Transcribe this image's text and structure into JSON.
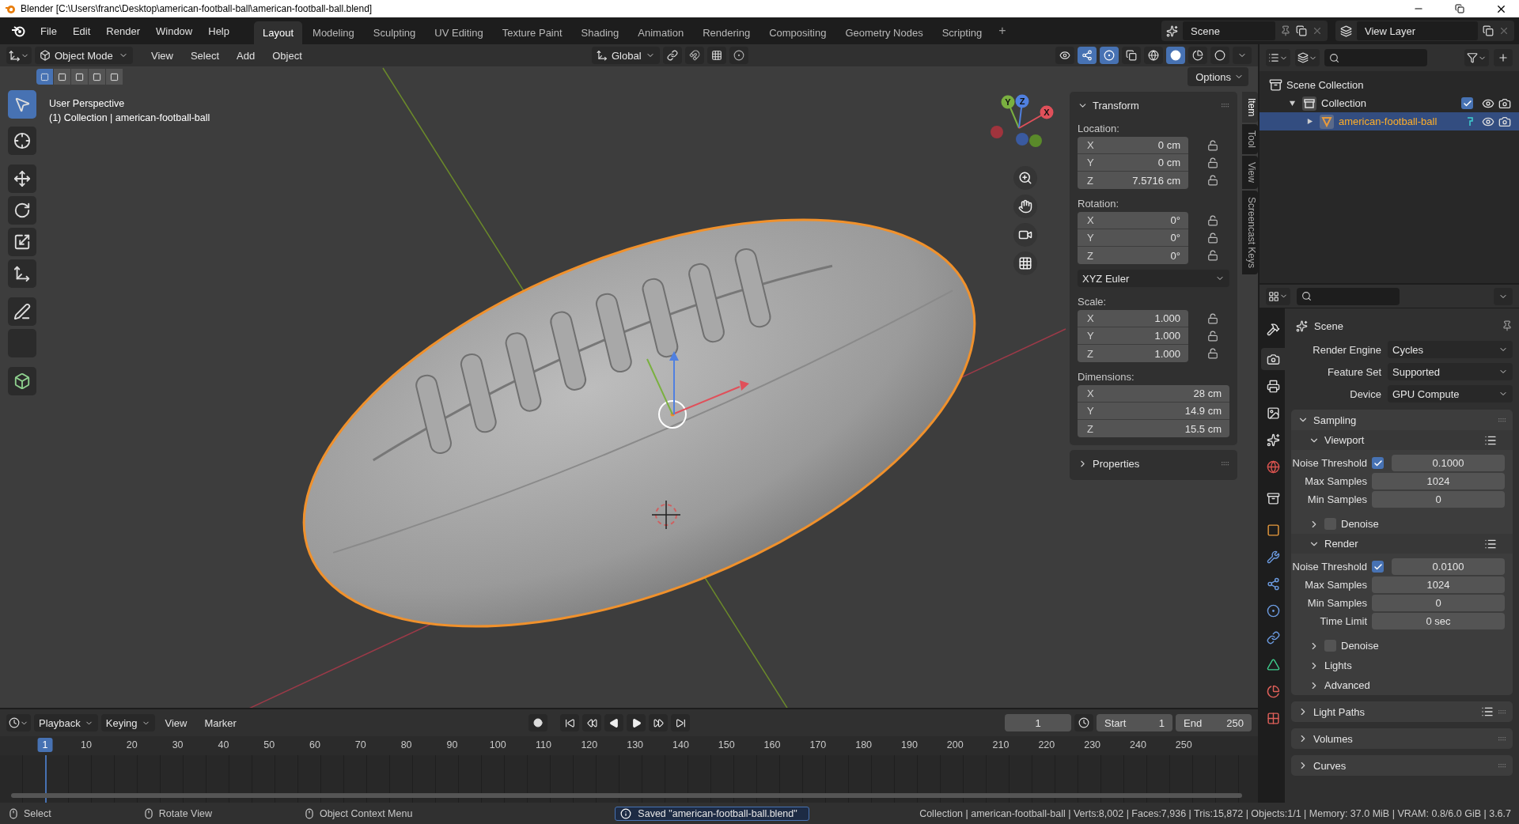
{
  "window": {
    "title": "Blender [C:\\Users\\franc\\Desktop\\american-football-ball\\american-football-ball.blend]"
  },
  "menu": [
    "File",
    "Edit",
    "Render",
    "Window",
    "Help"
  ],
  "workspaces": [
    {
      "label": "Layout",
      "selected": true
    },
    {
      "label": "Modeling",
      "selected": false
    },
    {
      "label": "Sculpting",
      "selected": false
    },
    {
      "label": "UV Editing",
      "selected": false
    },
    {
      "label": "Texture Paint",
      "selected": false
    },
    {
      "label": "Shading",
      "selected": false
    },
    {
      "label": "Animation",
      "selected": false
    },
    {
      "label": "Rendering",
      "selected": false
    },
    {
      "label": "Compositing",
      "selected": false
    },
    {
      "label": "Geometry Nodes",
      "selected": false
    },
    {
      "label": "Scripting",
      "selected": false
    }
  ],
  "add_workspace": "+",
  "scene": "Scene",
  "view_layer": "View Layer",
  "viewport": {
    "mode": "Object Mode",
    "menus": [
      "View",
      "Select",
      "Add",
      "Object"
    ],
    "orientation": "Global",
    "options": "Options",
    "select_modes": [
      {
        "selected": true
      },
      {
        "selected": false
      },
      {
        "selected": false
      },
      {
        "selected": false
      },
      {
        "selected": false
      }
    ],
    "overlay": [
      "User Perspective",
      "(1) Collection | american-football-ball"
    ],
    "gizmo_axes": [
      "X",
      "Y",
      "Z"
    ],
    "tools": [
      {
        "selected": true
      },
      {
        "selected": false
      },
      {
        "selected": false
      },
      {
        "selected": false
      },
      {
        "selected": false
      },
      {
        "selected": false
      },
      {
        "selected": false
      },
      {
        "selected": false
      },
      {
        "selected": false
      }
    ],
    "sidebar_tabs": [
      {
        "label": "Item",
        "selected": true
      },
      {
        "label": "Tool",
        "selected": false
      },
      {
        "label": "View",
        "selected": false
      },
      {
        "label": "Screencast Keys",
        "selected": false
      }
    ]
  },
  "transform": {
    "title": "Transform",
    "sections": [
      {
        "kind": "locked",
        "label": "Location:",
        "fields": [
          {
            "axis": "X",
            "value": "0 cm"
          },
          {
            "axis": "Y",
            "value": "0 cm"
          },
          {
            "axis": "Z",
            "value": "7.5716 cm"
          }
        ]
      },
      {
        "kind": "locked",
        "label": "Rotation:",
        "fields": [
          {
            "axis": "X",
            "value": "0°"
          },
          {
            "axis": "Y",
            "value": "0°"
          },
          {
            "axis": "Z",
            "value": "0°"
          }
        ]
      },
      {
        "kind": "dropdown",
        "value": "XYZ Euler"
      },
      {
        "kind": "locked",
        "label": "Scale:",
        "fields": [
          {
            "axis": "X",
            "value": "1.000"
          },
          {
            "axis": "Y",
            "value": "1.000"
          },
          {
            "axis": "Z",
            "value": "1.000"
          }
        ]
      },
      {
        "kind": "plain",
        "label": "Dimensions:",
        "fields": [
          {
            "axis": "X",
            "value": "28 cm"
          },
          {
            "axis": "Y",
            "value": "14.9 cm"
          },
          {
            "axis": "Z",
            "value": "15.5 cm"
          }
        ]
      }
    ],
    "collapsed_panel": "Properties"
  },
  "outliner": {
    "items": [
      {
        "kind": "scene_collection",
        "label": "Scene Collection",
        "children": [
          {
            "kind": "collection",
            "label": "Collection",
            "expanded": true,
            "checked": true,
            "selected": false,
            "children": [
              {
                "kind": "mesh_object",
                "label": "american-football-ball",
                "expanded": false,
                "selected": true
              }
            ]
          }
        ]
      }
    ]
  },
  "properties": {
    "context": "Scene",
    "tabs": [
      {
        "selected": false
      },
      {
        "selected": true
      },
      {
        "selected": false
      },
      {
        "selected": false
      },
      {
        "selected": false
      },
      {
        "selected": false
      },
      {
        "selected": false
      },
      {
        "selected": false
      },
      {
        "selected": false
      },
      {
        "selected": false
      },
      {
        "selected": false
      },
      {
        "selected": false
      },
      {
        "selected": false
      },
      {
        "selected": false
      },
      {
        "selected": false
      }
    ],
    "settings": [
      {
        "label": "Render Engine",
        "value": "Cycles"
      },
      {
        "label": "Feature Set",
        "value": "Supported"
      },
      {
        "label": "Device",
        "value": "GPU Compute"
      }
    ],
    "panels": [
      {
        "title": "Sampling",
        "expanded": true,
        "presets": false,
        "children": [
          {
            "kind": "subpanel",
            "title": "Viewport",
            "expanded": true,
            "presets": true,
            "rows": [
              {
                "kind": "check_number",
                "label": "Noise Threshold",
                "checked": true,
                "value": "0.1000"
              },
              {
                "kind": "number",
                "label": "Max Samples",
                "value": "1024"
              },
              {
                "kind": "number",
                "label": "Min Samples",
                "value": "0"
              }
            ]
          },
          {
            "kind": "check_subpanel",
            "title": "Denoise",
            "expanded": false,
            "checked": false
          },
          {
            "kind": "subpanel",
            "title": "Render",
            "expanded": true,
            "presets": true,
            "rows": [
              {
                "kind": "check_number",
                "label": "Noise Threshold",
                "checked": true,
                "value": "0.0100"
              },
              {
                "kind": "number",
                "label": "Max Samples",
                "value": "1024"
              },
              {
                "kind": "number",
                "label": "Min Samples",
                "value": "0"
              },
              {
                "kind": "number",
                "label": "Time Limit",
                "value": "0 sec"
              }
            ]
          },
          {
            "kind": "check_subpanel",
            "title": "Denoise",
            "expanded": false,
            "checked": false
          },
          {
            "kind": "subpanel",
            "title": "Lights",
            "expanded": false,
            "presets": false
          },
          {
            "kind": "subpanel",
            "title": "Advanced",
            "expanded": false,
            "presets": false
          }
        ]
      },
      {
        "title": "Light Paths",
        "expanded": false,
        "presets": true
      },
      {
        "title": "Volumes",
        "expanded": false,
        "presets": false
      },
      {
        "title": "Curves",
        "expanded": false,
        "presets": false
      }
    ]
  },
  "timeline": {
    "menus": [
      {
        "label": "Playback",
        "dropdown": true
      },
      {
        "label": "Keying",
        "dropdown": true
      },
      {
        "label": "View",
        "dropdown": false
      },
      {
        "label": "Marker",
        "dropdown": false
      }
    ],
    "current_frame": "1",
    "start_label": "Start",
    "start": "1",
    "end_label": "End",
    "end": "250",
    "playhead": "1",
    "ruler": [
      "10",
      "20",
      "30",
      "40",
      "50",
      "60",
      "70",
      "80",
      "90",
      "100",
      "110",
      "120",
      "130",
      "140",
      "150",
      "160",
      "170",
      "180",
      "190",
      "200",
      "210",
      "220",
      "230",
      "240",
      "250"
    ]
  },
  "status_bar": {
    "hints": [
      "Select",
      "Rotate View",
      "Object Context Menu"
    ],
    "report": "Saved \"american-football-ball.blend\"",
    "stats": "Collection | american-football-ball | Verts:8,002 | Faces:7,936 | Tris:15,872 | Objects:1/1 | Memory: 37.0 MiB | VRAM: 0.8/6.0 GiB | 3.6.7"
  }
}
